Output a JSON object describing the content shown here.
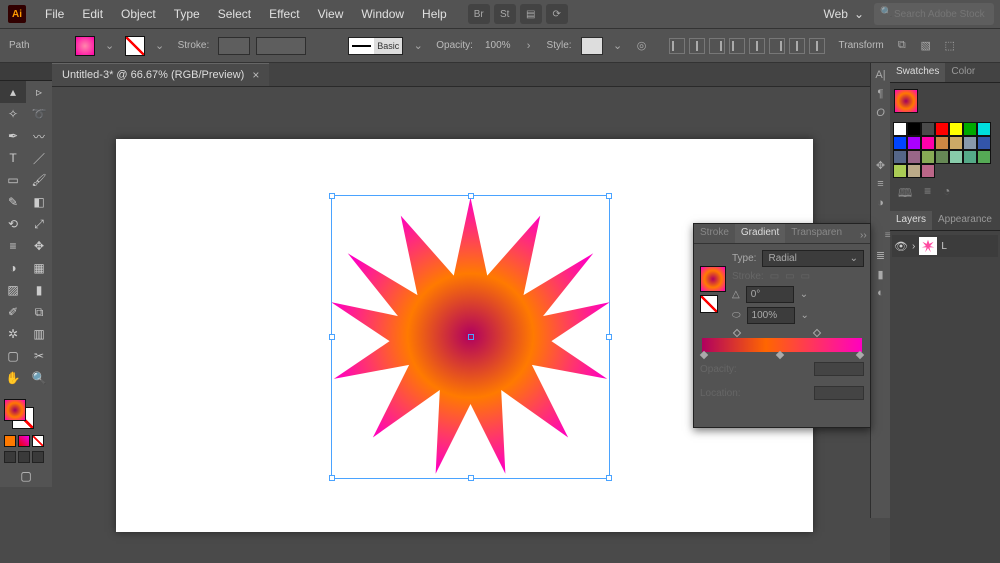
{
  "menubar": {
    "items": [
      "File",
      "Edit",
      "Object",
      "Type",
      "Select",
      "Effect",
      "View",
      "Window",
      "Help"
    ],
    "workspace": "Web",
    "search_placeholder": "Search Adobe Stock"
  },
  "optbar": {
    "path_label": "Path",
    "stroke_label": "Stroke:",
    "stroke_val": "",
    "brush_label": "Basic",
    "opacity_label": "Opacity:",
    "opacity_val": "100%",
    "style_label": "Style:",
    "transform_label": "Transform"
  },
  "tab": {
    "title": "Untitled-3* @ 66.67% (RGB/Preview)"
  },
  "gradpanel": {
    "tabs": [
      "Stroke",
      "Gradient",
      "Transparen"
    ],
    "type_label": "Type:",
    "type_val": "Radial",
    "stroke_label": "Stroke:",
    "angle_label": "0°",
    "ratio_label": "100%",
    "opacity_label": "Opacity:",
    "location_label": "Location:"
  },
  "right": {
    "swatches_tab": "Swatches",
    "color_tab": "Color",
    "layers_tab": "Layers",
    "appear_tab": "Appearance",
    "layer1": "L"
  },
  "swatch_colors": [
    "#ffffff",
    "#000000",
    "#4a4a4a",
    "#ff0000",
    "#ffff00",
    "#00aa00",
    "#00dddd",
    "#0044ff",
    "#aa00ff",
    "#ff00aa",
    "#cc8844",
    "#ccaa66",
    "#8899aa",
    "#3355aa",
    "#556688",
    "#996688",
    "#88aa55",
    "#668855",
    "#88ccaa",
    "#55aa88",
    "#55aa55",
    "#aacc55",
    "#bbaa88",
    "#bb6688"
  ]
}
